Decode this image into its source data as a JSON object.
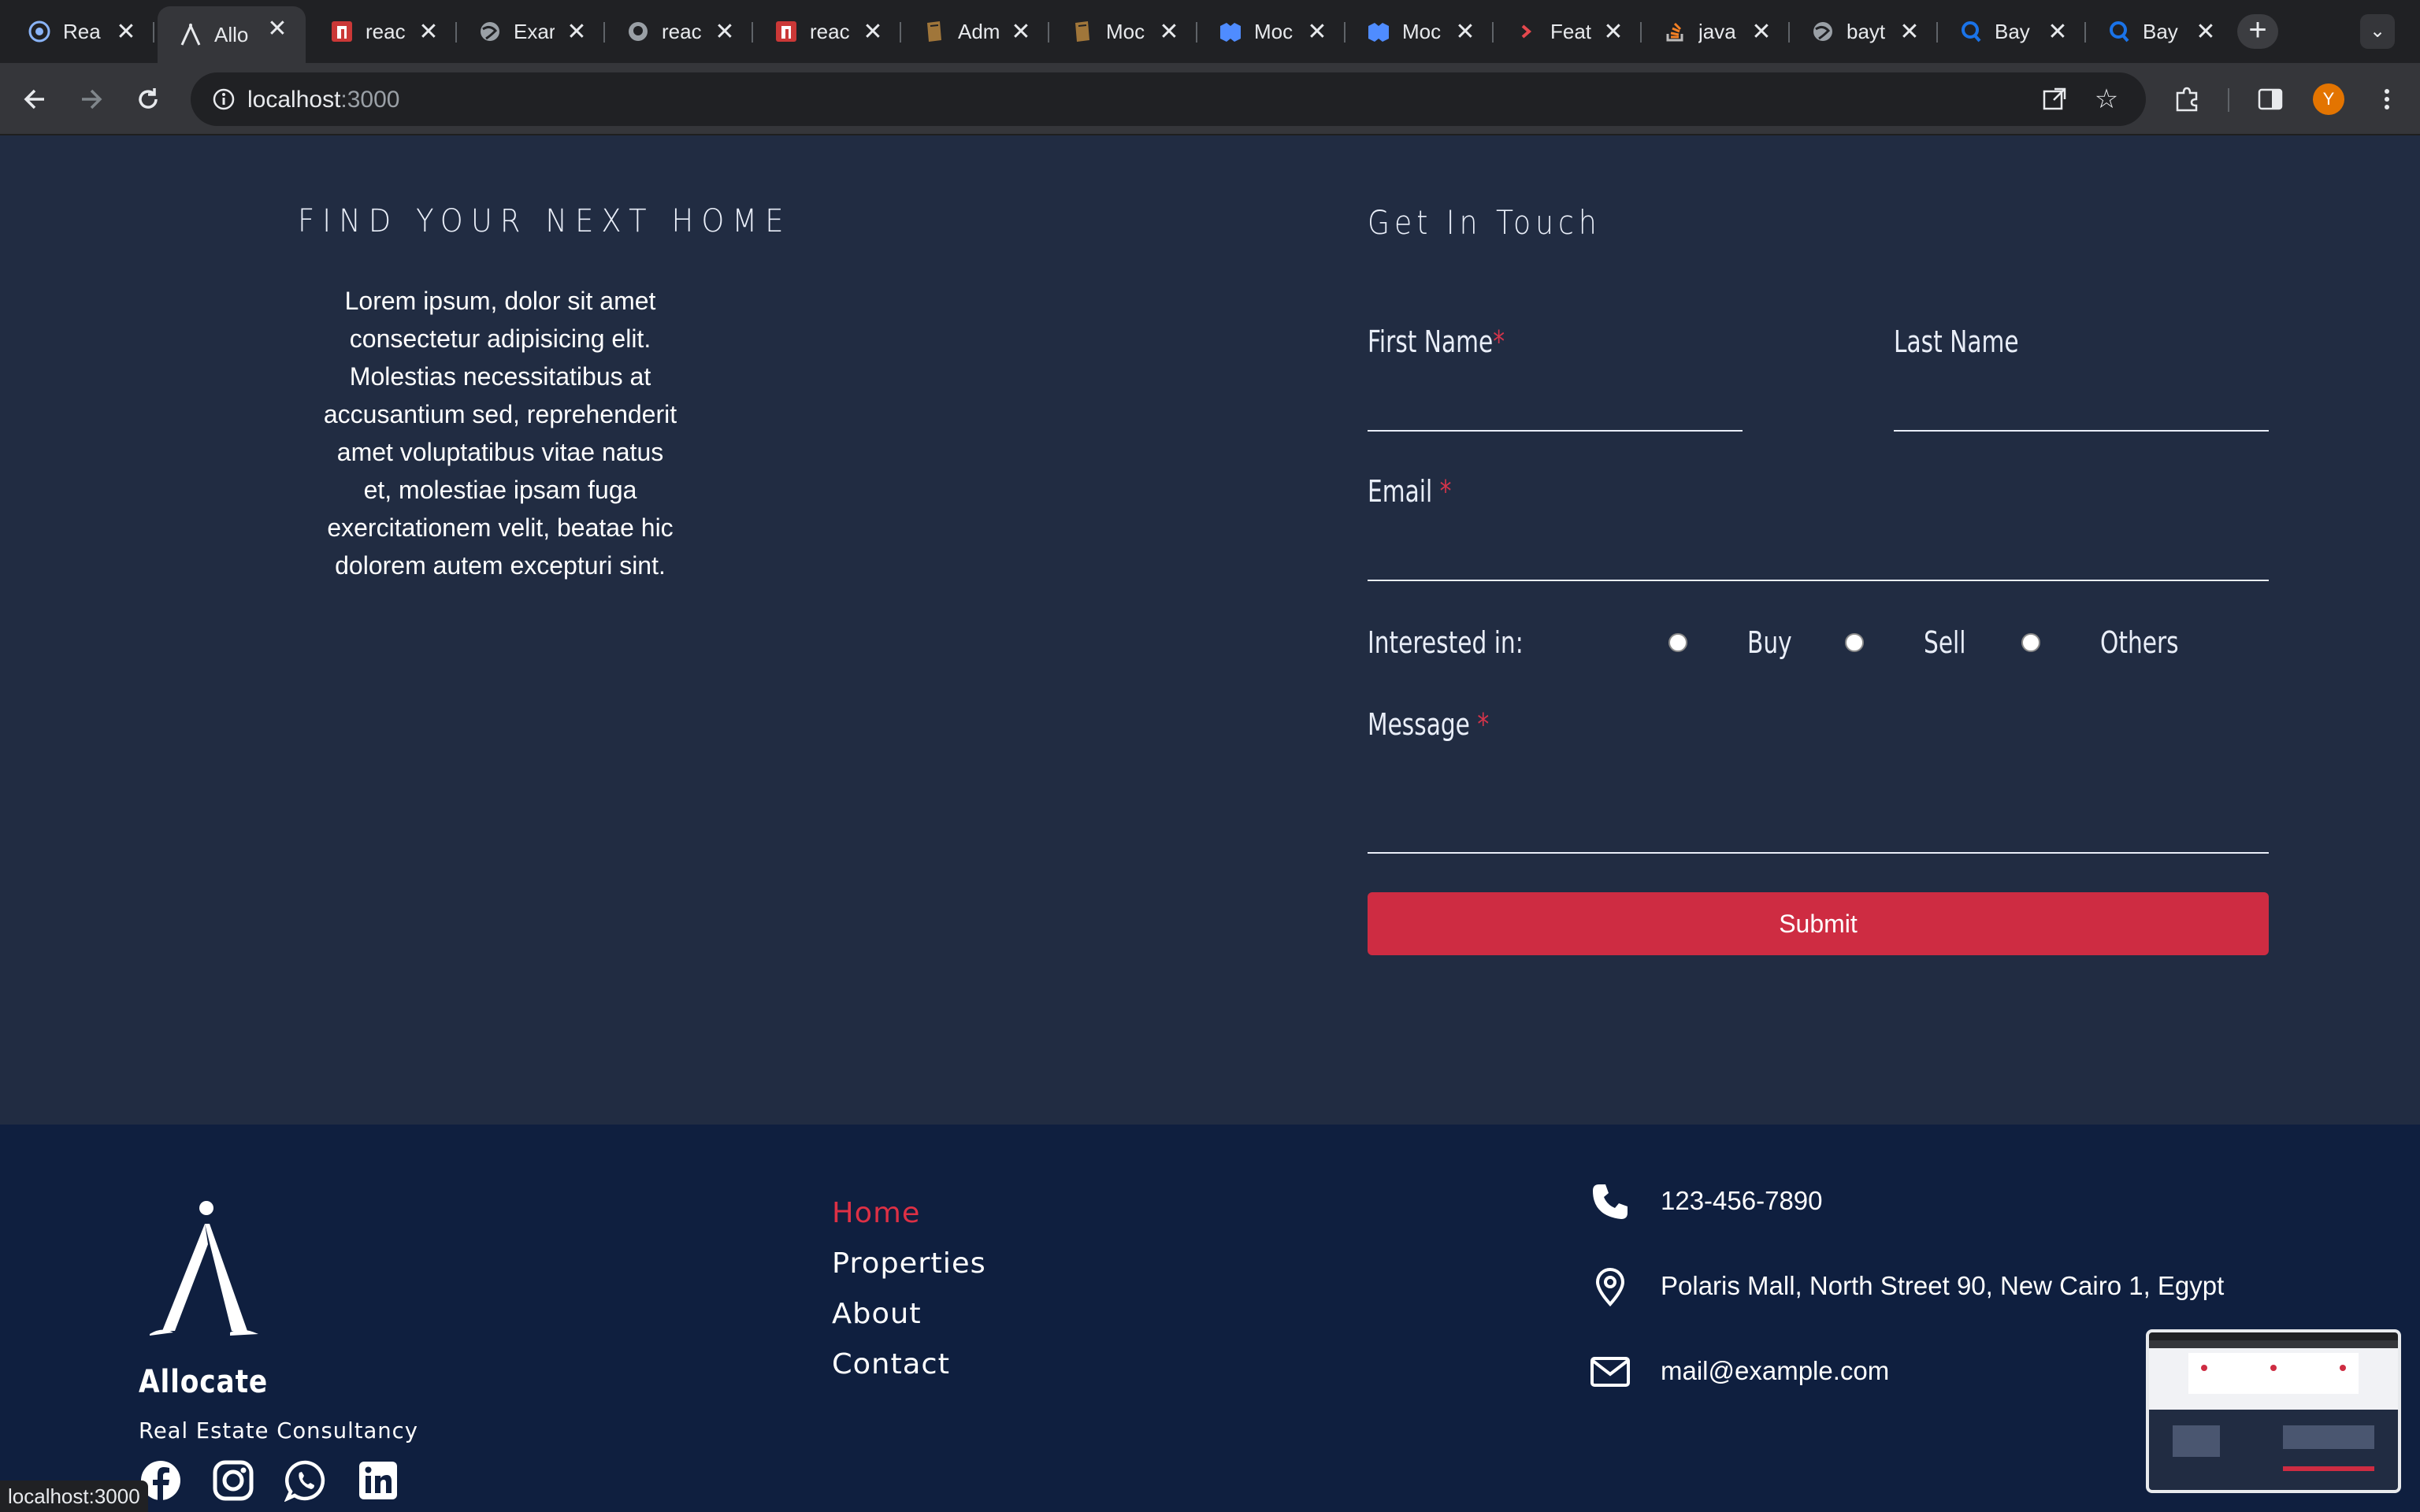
{
  "browser": {
    "tabs": [
      {
        "title": "Rea",
        "icon": "globe-icon"
      },
      {
        "title": "Allo",
        "icon": "allocate-logo-icon",
        "active": true
      },
      {
        "title": "reac",
        "icon": "npm-icon"
      },
      {
        "title": "Exar",
        "icon": "globe-icon"
      },
      {
        "title": "reac",
        "icon": "github-icon"
      },
      {
        "title": "reac",
        "icon": "npm-icon"
      },
      {
        "title": "Adm",
        "icon": "book-icon"
      },
      {
        "title": "Moc",
        "icon": "book-icon"
      },
      {
        "title": "Moc",
        "icon": "mui-icon"
      },
      {
        "title": "Moc",
        "icon": "mui-icon"
      },
      {
        "title": "Feat",
        "icon": "chevron-icon"
      },
      {
        "title": "java",
        "icon": "stackoverflow-icon"
      },
      {
        "title": "bayt",
        "icon": "globe-icon"
      },
      {
        "title": "Bay",
        "icon": "search-q-icon"
      },
      {
        "title": "Bay",
        "icon": "search-q-icon"
      }
    ],
    "url_host": "localhost",
    "url_port": ":3000",
    "profile_initial": "Y",
    "status_url": "localhost:3000"
  },
  "find_section": {
    "title": "FIND YOUR NEXT HOME",
    "text": "Lorem ipsum, dolor sit amet consectetur adipisicing elit. Molestias necessitatibus at accusantium sed, reprehenderit amet voluptatibus vitae natus et, molestiae ipsam fuga exercitationem velit, beatae hic dolorem autem excepturi sint."
  },
  "contact_form": {
    "title": "Get In Touch",
    "first_name_label": "First Name",
    "last_name_label": "Last Name",
    "email_label": "Email",
    "required_mark": "*",
    "interested_label": "Interested in:",
    "options": [
      "Buy",
      "Sell",
      "Others"
    ],
    "message_label": "Message",
    "submit_label": "Submit"
  },
  "footer": {
    "brand": "Allocate",
    "tagline": "Real Estate Consultancy",
    "nav": [
      "Home",
      "Properties",
      "About",
      "Contact"
    ],
    "phone": "123-456-7890",
    "address": "Polaris Mall, North Street 90, New Cairo 1, Egypt",
    "email": "mail@example.com",
    "socials": [
      "facebook-icon",
      "instagram-icon",
      "whatsapp-icon",
      "linkedin-icon"
    ]
  },
  "colors": {
    "section_bg": "#212c42",
    "footer_bg": "#0f1f3f",
    "accent": "#ce2c42"
  }
}
